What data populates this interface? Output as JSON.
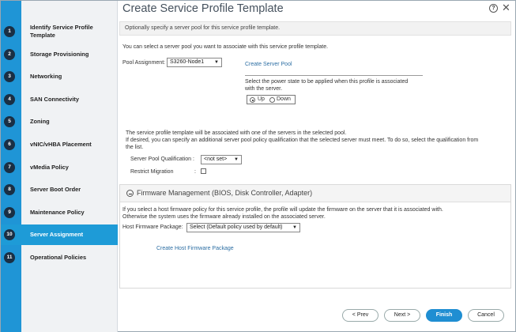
{
  "window": {
    "title": "Create Service Profile Template",
    "help_glyph": "?",
    "close_glyph": "✕"
  },
  "steps": [
    {
      "num": "1",
      "label": "Identify Service Profile Template",
      "active": false
    },
    {
      "num": "2",
      "label": "Storage Provisioning",
      "active": false
    },
    {
      "num": "3",
      "label": "Networking",
      "active": false
    },
    {
      "num": "4",
      "label": "SAN Connectivity",
      "active": false
    },
    {
      "num": "5",
      "label": "Zoning",
      "active": false
    },
    {
      "num": "6",
      "label": "vNIC/vHBA Placement",
      "active": false
    },
    {
      "num": "7",
      "label": "vMedia Policy",
      "active": false
    },
    {
      "num": "8",
      "label": "Server Boot Order",
      "active": false
    },
    {
      "num": "9",
      "label": "Maintenance Policy",
      "active": false
    },
    {
      "num": "10",
      "label": "Server Assignment",
      "active": true
    },
    {
      "num": "11",
      "label": "Operational Policies",
      "active": false
    }
  ],
  "info": "Optionally specify a server pool for this service profile template.",
  "pool": {
    "intro": "You can select a server pool you want to associate with this service profile template.",
    "label": "Pool Assignment:",
    "value": "S3260-Node1",
    "create_link": "Create Server Pool"
  },
  "power": {
    "text_line1": "Select the power state to be applied when this profile is associated",
    "text_line2": "with the server.",
    "options": [
      "Up",
      "Down"
    ],
    "selected": "Up"
  },
  "qualification": {
    "line1": "The service profile template will be associated with one of the servers in the selected pool.",
    "line2": "If desired, you can specify an additional server pool policy qualification that the selected server must meet. To do so, select the qualification from",
    "line3": "the list.",
    "label": "Server Pool Qualification :",
    "value": "<not set>",
    "restrict_label": "Restrict Migration",
    "restrict_colon": ":",
    "restrict_checked": false
  },
  "firmware": {
    "title": "Firmware Management (BIOS, Disk Controller, Adapter)",
    "line1": "If you select a host firmware policy for this service profile, the profile will update the firmware on the server that it is associated with.",
    "line2": "Otherwise the system uses the firmware already installed on the associated server.",
    "label": "Host Firmware Package:",
    "value": "Select (Default policy used by default)",
    "create_link": "Create Host Firmware Package"
  },
  "buttons": {
    "prev": "< Prev",
    "next": "Next >",
    "finish": "Finish",
    "cancel": "Cancel"
  },
  "colors": {
    "accent": "#1f95d6",
    "primary_button": "#1f8ed2",
    "step_badge": "#1a2f44",
    "link": "#2c6ea3"
  }
}
